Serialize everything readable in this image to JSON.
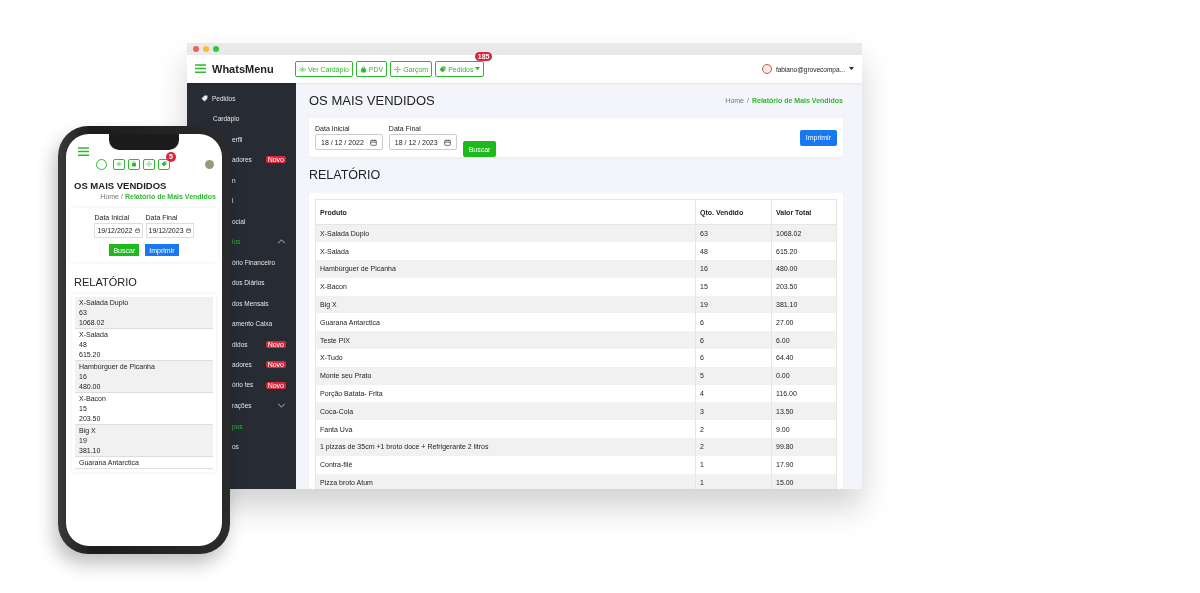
{
  "browser": {
    "brand": "WhatsMenu",
    "nav_buttons": [
      {
        "label": "Ver Cardápio"
      },
      {
        "label": "PDV"
      },
      {
        "label": "Garçom"
      },
      {
        "label": "Pedidos",
        "badge": "185"
      }
    ],
    "user": "fabiano@grovecompa...",
    "sidebar": {
      "items": [
        {
          "kind": "icon",
          "label": "Pedidos",
          "active": false
        },
        {
          "kind": "text",
          "label": "Cardápio",
          "active": false
        },
        {
          "kind": "cut",
          "label": "erfil",
          "active": false
        },
        {
          "kind": "cut",
          "label": "adores",
          "badge": "Novo",
          "active": false
        },
        {
          "kind": "cut",
          "label": "n",
          "active": false
        },
        {
          "kind": "cut",
          "label": "l",
          "active": false
        },
        {
          "kind": "cut",
          "label": "ocial",
          "active": false
        },
        {
          "kind": "section",
          "label": "ios",
          "expanded": true,
          "active": true
        },
        {
          "kind": "cut",
          "label": "ório Financeiro",
          "active": false
        },
        {
          "kind": "cut",
          "label": "dos Diários",
          "active": false
        },
        {
          "kind": "cut",
          "label": "dos Mensais",
          "active": false
        },
        {
          "kind": "cut",
          "label": "amento Caixa",
          "active": false
        },
        {
          "kind": "cut",
          "label": "didos",
          "badge": "Novo",
          "active": false
        },
        {
          "kind": "cut",
          "label": "adores",
          "badge": "Novo",
          "active": false
        },
        {
          "kind": "cut",
          "label": "ório tes",
          "badge": "Novo",
          "active": false
        },
        {
          "kind": "section",
          "label": "rações",
          "expanded": false,
          "active": false
        },
        {
          "kind": "cut",
          "label": "pos",
          "active": true
        },
        {
          "kind": "cut",
          "label": "os",
          "active": false
        }
      ]
    },
    "page_title": "OS MAIS VENDIDOS",
    "breadcrumb": {
      "items": [
        "Home",
        "Relatório de Mais Vendidos"
      ],
      "separator": "/"
    },
    "filters": {
      "fields": [
        {
          "label": "Data Inicial",
          "value": "18 / 12 / 2022"
        },
        {
          "label": "Data Final",
          "value": "18 / 12 / 2023"
        }
      ],
      "search_button": "Buscar",
      "print_button": "Imprimir"
    },
    "report_title": "RELATÓRIO",
    "table": {
      "columns": [
        "Produto",
        "Qto. Vendido",
        "Valor Total"
      ],
      "rows": [
        [
          "X-Salada Duplo",
          "63",
          "1068.02"
        ],
        [
          "X-Salada",
          "48",
          "615.20"
        ],
        [
          "Hambúrguer de Picanha",
          "16",
          "480.00"
        ],
        [
          "X-Bacon",
          "15",
          "203.50"
        ],
        [
          "Big X",
          "19",
          "381.10"
        ],
        [
          "Guarana Antarctica",
          "6",
          "27.00"
        ],
        [
          "Teste PIX",
          "6",
          "6.00"
        ],
        [
          "X-Tudo",
          "6",
          "64.40"
        ],
        [
          "Monte seu Prato",
          "5",
          "0.00"
        ],
        [
          "Porção Batata- Frita",
          "4",
          "116.00"
        ],
        [
          "Coca-Cola",
          "3",
          "13.50"
        ],
        [
          "Fanta Uva",
          "2",
          "9.00"
        ],
        [
          "1 pizzas de 35cm +1 broto doce + Refrigerante 2 litros",
          "2",
          "99.80"
        ],
        [
          "Contra-filé",
          "1",
          "17.90"
        ],
        [
          "Pizza broto Atum",
          "1",
          "15.00"
        ]
      ]
    }
  },
  "phone": {
    "orders_badge": "5",
    "page_title": "OS MAIS VENDIDOS",
    "breadcrumb": {
      "items": [
        "Home",
        "Relatório de Mais Vendidos"
      ],
      "separator": "/"
    },
    "fields": [
      {
        "label": "Data Inicial",
        "value": "19/12/2022"
      },
      {
        "label": "Data Final",
        "value": "19/12/2023"
      }
    ],
    "search_button": "Buscar",
    "print_button": "Imprimir",
    "report_title": "RELATÓRIO",
    "items": [
      {
        "lines": [
          "X-Salada Duplo",
          "63",
          "1068.02"
        ]
      },
      {
        "lines": [
          "X-Salada",
          "48",
          "615.20"
        ]
      },
      {
        "lines": [
          "Hambúrguer de Picanha",
          "16",
          "480.00"
        ]
      },
      {
        "lines": [
          "X-Bacon",
          "15",
          "203.50"
        ]
      },
      {
        "lines": [
          "Big X",
          "19",
          "381.10"
        ]
      },
      {
        "lines": [
          "Guarana Antarctica"
        ]
      }
    ]
  }
}
